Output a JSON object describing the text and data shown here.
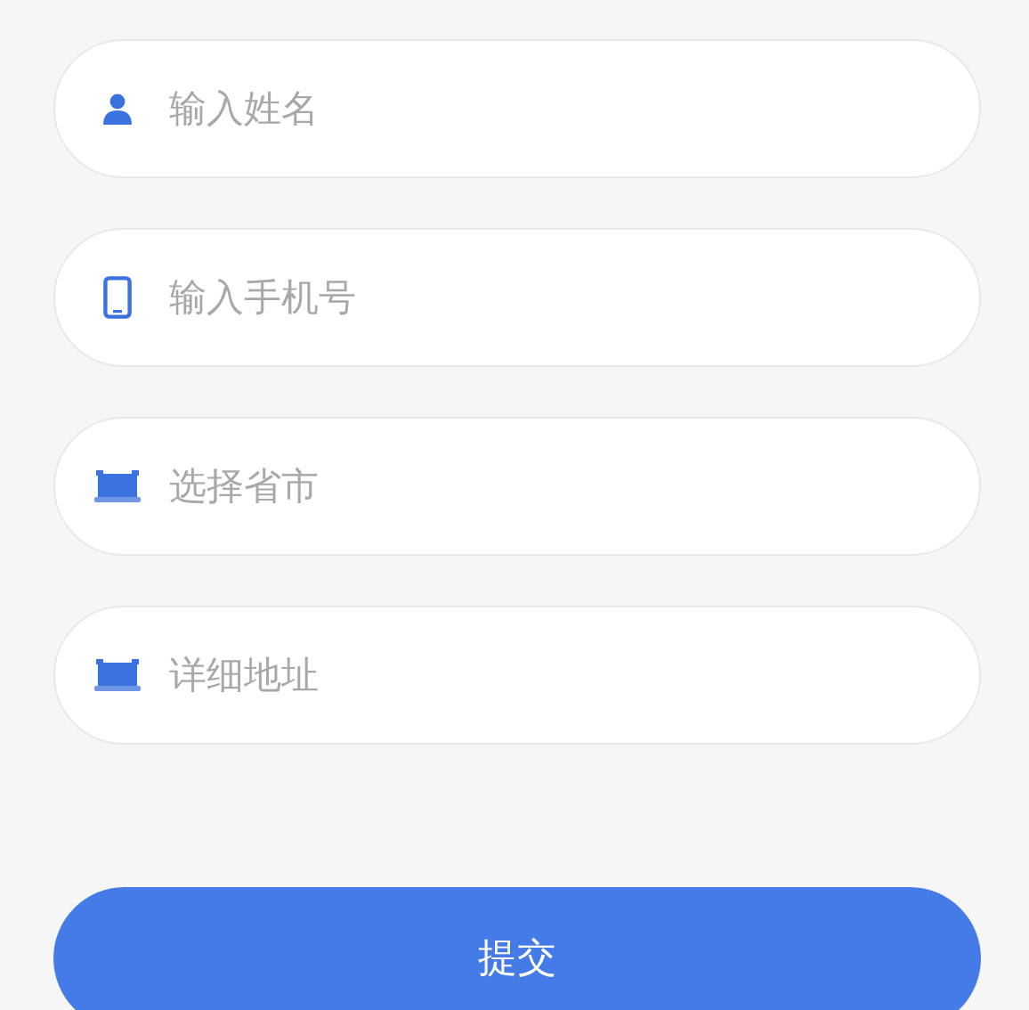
{
  "fields": [
    {
      "kind": "person",
      "placeholder": "输入姓名"
    },
    {
      "kind": "phone",
      "placeholder": "输入手机号"
    },
    {
      "kind": "tray",
      "placeholder": "选择省市"
    },
    {
      "kind": "tray",
      "placeholder": "详细地址"
    }
  ],
  "submit_button": {
    "label": "提交"
  }
}
